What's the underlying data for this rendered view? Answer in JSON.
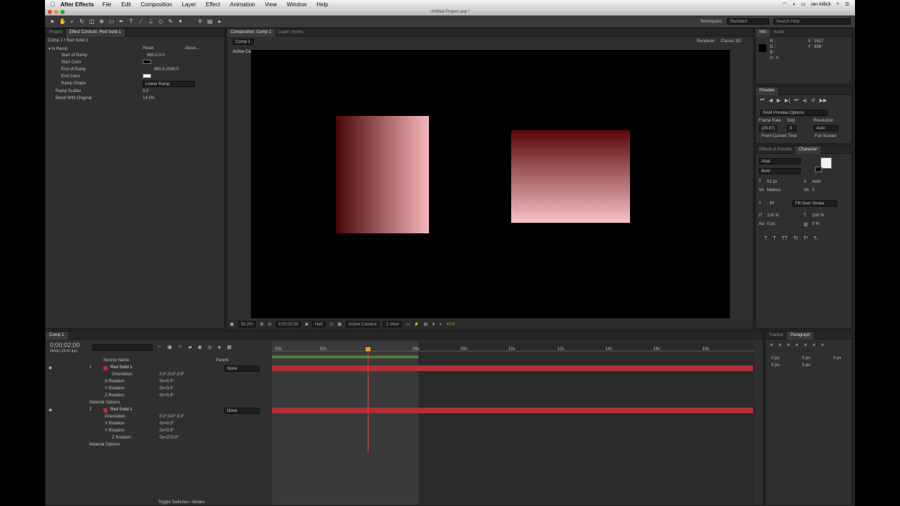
{
  "menubar": {
    "app_name": "After Effects",
    "items": [
      "File",
      "Edit",
      "Composition",
      "Layer",
      "Effect",
      "Animation",
      "View",
      "Window",
      "Help"
    ],
    "user": "ian killick"
  },
  "window_title": "Untitled Project.aep *",
  "toolbar": {
    "workspace_label": "Workspace:",
    "workspace_value": "Standard",
    "search_placeholder": "Search Help"
  },
  "project_panel": {
    "tabs": [
      "Project",
      "Effect Controls: Red Solid 1"
    ],
    "header": "Comp 1 • Red Solid 1",
    "effect_name": "Ramp",
    "reset_label": "Reset",
    "about_label": "About...",
    "properties": [
      {
        "name": "Start of Ramp",
        "value": "960.0,0.0"
      },
      {
        "name": "Start Color",
        "value": ""
      },
      {
        "name": "End of Ramp",
        "value": "960.0,1080.0"
      },
      {
        "name": "End Color",
        "value": ""
      },
      {
        "name": "Ramp Shape",
        "value": "Linear Ramp"
      },
      {
        "name": "Ramp Scatter",
        "value": "0.0"
      },
      {
        "name": "Blend With Original",
        "value": "14.0%"
      }
    ]
  },
  "composition_panel": {
    "tabs": [
      "Composition: Comp 1",
      "Layer: (none)"
    ],
    "comp_tab": "Comp 1",
    "renderer_label": "Renderer:",
    "renderer_value": "Classic 3D",
    "camera_label": "Active Camera",
    "footer": {
      "zoom": "50.2%",
      "timecode": "0;00;02;00",
      "resolution": "Half",
      "view": "Active Camera",
      "views": "1 View",
      "exposure": "+0.0"
    }
  },
  "info_panel": {
    "tabs": [
      "Info",
      "Audio"
    ],
    "channels": [
      "R :",
      "G :",
      "B :",
      "A : 0"
    ],
    "x": "X : 1817",
    "y": "Y : 838"
  },
  "preview_panel": {
    "title": "Preview",
    "ram_options": "RAM Preview Options",
    "frame_rate_label": "Frame Rate",
    "skip_label": "Skip",
    "resolution_label": "Resolution",
    "frame_rate": "(29.97)",
    "skip": "0",
    "resolution": "Auto",
    "from_current": "From Current Time",
    "full_screen": "Full Screen"
  },
  "character_panel": {
    "tabs": [
      "Effects & Presets",
      "Character"
    ],
    "font": "Arial",
    "style": "Bold",
    "size": "61 px",
    "leading": "Auto",
    "tracking": "0",
    "kerning": "Metrics",
    "stroke": "- px",
    "stroke_type": "Fill Over Stroke",
    "vscale": "100 %",
    "hscale": "100 %",
    "baseline": "0 px",
    "tsume": "0 %"
  },
  "paragraph_panel": {
    "tabs": [
      "Tracker",
      "Paragraph"
    ],
    "values": [
      "0 px",
      "0 px",
      "0 px",
      "0 px",
      "0 px"
    ]
  },
  "timeline": {
    "tab": "Comp 1",
    "timecode": "0;00;02;00",
    "frame_info": "00060 (29.97 fps)",
    "header": {
      "source_name": "Source Name",
      "parent": "Parent"
    },
    "ruler": [
      "00s",
      "02s",
      "04s",
      "06s",
      "08s",
      "10s",
      "12s",
      "14s",
      "16s",
      "18s",
      "20s"
    ],
    "layers": [
      {
        "index": "1",
        "name": "Red Solid 1",
        "parent": "None",
        "properties": [
          {
            "name": "Orientation",
            "value": "0.0°,0.0°,0.0°"
          },
          {
            "name": "X Rotation",
            "value": "0x+0.0°"
          },
          {
            "name": "Y Rotation",
            "value": "0x+0.0°"
          },
          {
            "name": "Z Rotation",
            "value": "0x+0.0°"
          },
          {
            "name": "Material Options",
            "value": ""
          }
        ]
      },
      {
        "index": "2",
        "name": "Red Solid 1",
        "parent": "None",
        "properties": [
          {
            "name": "Orientation",
            "value": "0.0°,0.0°,0.0°"
          },
          {
            "name": "X Rotation",
            "value": "0x+0.0°"
          },
          {
            "name": "Y Rotation",
            "value": "0x+0.0°"
          },
          {
            "name": "Z Rotation",
            "value": "0x+270.0°"
          },
          {
            "name": "Material Options",
            "value": ""
          }
        ]
      }
    ],
    "footer_label": "Toggle Switches / Modes"
  },
  "colors": {
    "accent": "#e0a030",
    "layer_bar": "#b0303a",
    "panel_bg": "#2f2f2f",
    "ramp_start_1": "#4a0508",
    "ramp_end_1": "#f6b8bd",
    "ramp_start_2": "#5a0508",
    "ramp_end_2": "#f7c3c6"
  }
}
